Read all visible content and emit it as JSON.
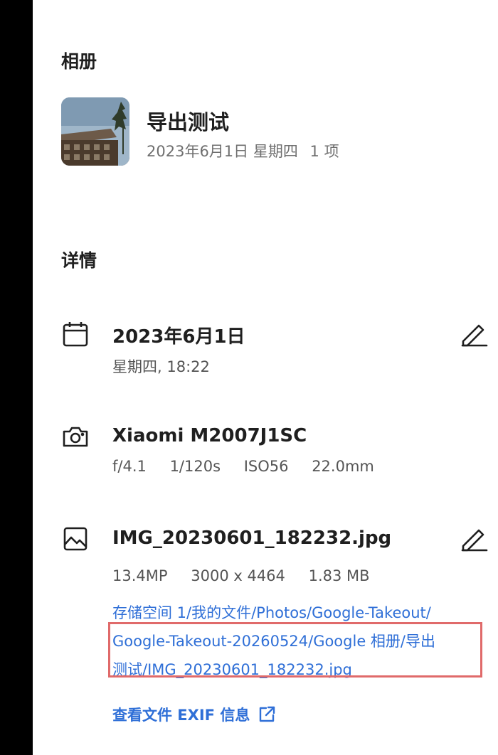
{
  "album_section": {
    "title": "相册",
    "album": {
      "name": "导出测试",
      "date": "2023年6月1日 星期四",
      "count": "1 项"
    }
  },
  "details_section": {
    "title": "详情",
    "date_row": {
      "icon": "calendar-icon",
      "title": "2023年6月1日",
      "subtitle": "星期四, 18:22"
    },
    "camera_row": {
      "icon": "camera-icon",
      "title": "Xiaomi M2007J1SC",
      "aperture": "f/4.1",
      "shutter": "1/120s",
      "iso": "ISO56",
      "focal_length": "22.0mm"
    },
    "file_row": {
      "icon": "image-icon",
      "title": "IMG_20230601_182232.jpg",
      "megapixels": "13.4MP",
      "resolution": "3000 x 4464",
      "size": "1.83 MB",
      "path_lines": [
        "存储空间 1/我的文件/Photos/Google-Takeout/",
        "Google-Takeout-20260524/Google 相册/导出",
        "测试/IMG_20230601_182232.jpg"
      ]
    },
    "exif_link": "查看文件 EXIF 信息"
  },
  "colors": {
    "accent": "#2f6fd7",
    "highlight": "#e06a6a",
    "left_bar": "#000000"
  }
}
